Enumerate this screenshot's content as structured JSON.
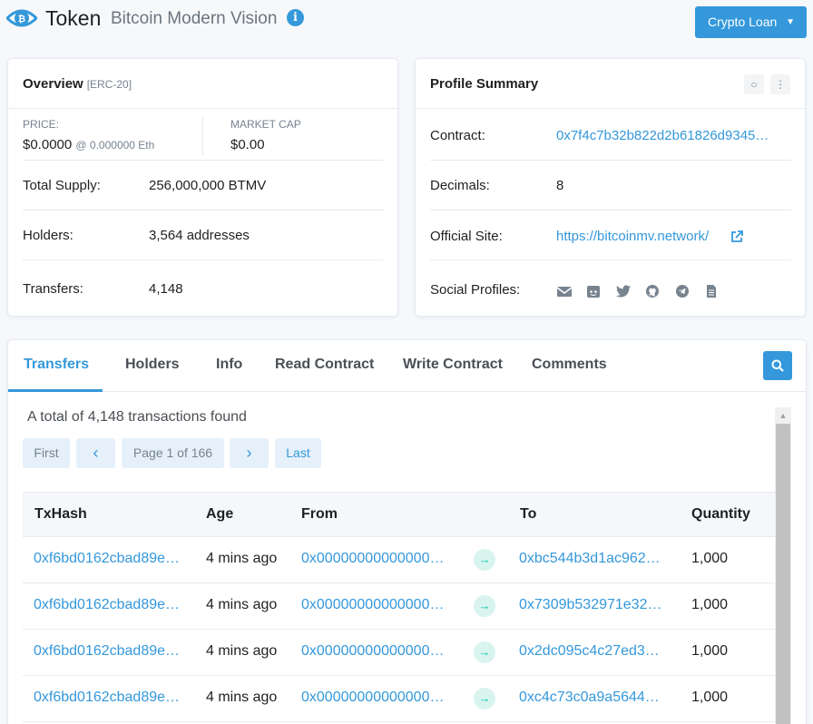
{
  "header": {
    "token_label": "Token",
    "token_name": "Bitcoin Modern Vision",
    "info_glyph": "i",
    "crypto_loan_label": "Crypto Loan"
  },
  "overview": {
    "title": "Overview",
    "subtitle": "[ERC-20]",
    "price_label": "PRICE:",
    "price_value": "$0.0000",
    "price_eth": "@ 0.000000 Eth",
    "marketcap_label": "MARKET CAP",
    "marketcap_value": "$0.00",
    "rows": [
      {
        "label": "Total Supply:",
        "value": "256,000,000 BTMV"
      },
      {
        "label": "Holders:",
        "value": "3,564 addresses"
      },
      {
        "label": "Transfers:",
        "value": "4,148"
      }
    ]
  },
  "profile": {
    "title": "Profile Summary",
    "rows": [
      {
        "label": "Contract:",
        "value": "0x7f4c7b32b822d2b61826d9345…"
      },
      {
        "label": "Decimals:",
        "value": "8"
      },
      {
        "label": "Official Site:",
        "value": "https://bitcoinmv.network/"
      },
      {
        "label": "Social Profiles:",
        "value": ""
      }
    ],
    "social_icons": [
      "email-icon",
      "reddit-icon",
      "twitter-icon",
      "github-icon",
      "telegram-icon",
      "document-icon"
    ]
  },
  "tabs": [
    "Transfers",
    "Holders",
    "Info",
    "Read Contract",
    "Write Contract",
    "Comments"
  ],
  "transfers": {
    "total_text": "A total of 4,148 transactions found",
    "pagination": {
      "first": "First",
      "prev": "‹",
      "page": "Page 1 of 166",
      "next": "›",
      "last": "Last"
    },
    "columns": [
      "TxHash",
      "Age",
      "From",
      "To",
      "Quantity"
    ],
    "rows": [
      {
        "hash": "0xf6bd0162cbad89e…",
        "age": "4 mins ago",
        "from": "0x00000000000000…",
        "to": "0xbc544b3d1ac962…",
        "qty": "1,000"
      },
      {
        "hash": "0xf6bd0162cbad89e…",
        "age": "4 mins ago",
        "from": "0x00000000000000…",
        "to": "0x7309b532971e32…",
        "qty": "1,000"
      },
      {
        "hash": "0xf6bd0162cbad89e…",
        "age": "4 mins ago",
        "from": "0x00000000000000…",
        "to": "0x2dc095c4c27ed3…",
        "qty": "1,000"
      },
      {
        "hash": "0xf6bd0162cbad89e…",
        "age": "4 mins ago",
        "from": "0x00000000000000…",
        "to": "0xc4c73c0a9a5644…",
        "qty": "1,000"
      }
    ]
  },
  "colors": {
    "accent": "#3498db",
    "success": "#00c9a7"
  }
}
